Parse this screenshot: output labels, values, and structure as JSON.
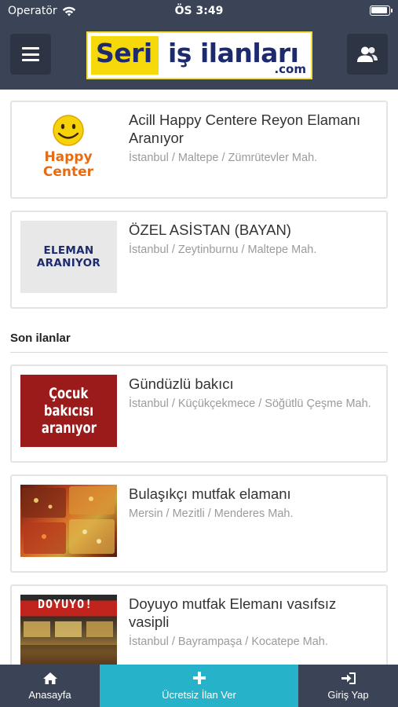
{
  "status_bar": {
    "carrier": "Operatör",
    "time": "ÖS 3:49"
  },
  "header": {
    "logo_seri": "Seri",
    "logo_is_ilanlari": "iş ilanları",
    "logo_com": ".com",
    "menu_icon": "menu-icon",
    "user_icon": "users-icon"
  },
  "featured": [
    {
      "title": "Acill Happy Centere Reyon Elamanı Aranıyor",
      "location": "İstanbul / Maltepe / Zümrütevler Mah.",
      "thumb_text": [
        "Happy",
        "Center"
      ]
    },
    {
      "title": "ÖZEL ASİSTAN (BAYAN)",
      "location": "İstanbul / Zeytinburnu / Maltepe Mah.",
      "thumb_text": [
        "ELEMAN",
        "ARANIYOR"
      ]
    }
  ],
  "recent_section": {
    "title": "Son ilanlar"
  },
  "recent": [
    {
      "title": "Gündüzlü bakıcı",
      "location": "İstanbul / Küçükçekmece / Söğütlü Çeşme Mah.",
      "thumb_text": [
        "Çocuk",
        "bakıcısı",
        "aranıyor"
      ]
    },
    {
      "title": "Bulaşıkçı mutfak elamanı",
      "location": "Mersin / Mezitli / Menderes Mah."
    },
    {
      "title": "Doyuyo mutfak Elemanı vasıfsız vasipli",
      "location": "İstanbul / Bayrampaşa / Kocatepe Mah.",
      "thumb_text": "DOYUYO!"
    }
  ],
  "tabbar": {
    "home": "Anasayfa",
    "post": "Ücretsiz İlan Ver",
    "login": "Giriş Yap"
  },
  "colors": {
    "header_bg": "#3b4456",
    "accent": "#26b3c9",
    "logo_yellow": "#f6d90b",
    "logo_navy": "#1e2a6e"
  }
}
